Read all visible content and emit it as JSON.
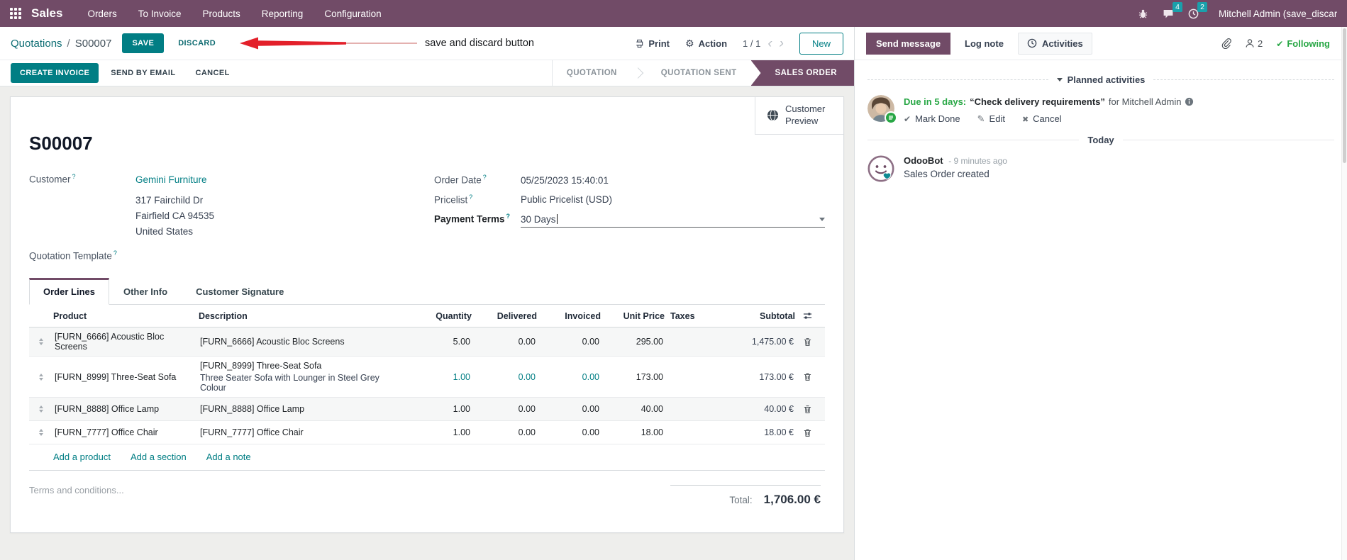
{
  "colors": {
    "brand": "#714B67",
    "accent": "#017E84",
    "badge_teal": "#1AA0AB",
    "success_green": "#28a745",
    "annotation_red": "#E3202A"
  },
  "topbar": {
    "app_name": "Sales",
    "menus": [
      "Orders",
      "To Invoice",
      "Products",
      "Reporting",
      "Configuration"
    ],
    "messages_badge": "4",
    "activities_badge": "2",
    "user_name": "Mitchell Admin (save_discar"
  },
  "control_panel": {
    "breadcrumb": "Quotations",
    "breadcrumb_sep": "/",
    "breadcrumb_active": "S00007",
    "save_label": "SAVE",
    "discard_label": "DISCARD",
    "annotation": "save and discard button",
    "print_label": "Print",
    "action_label": "Action",
    "pager": "1 / 1",
    "new_label": "New"
  },
  "statusbar": {
    "buttons": [
      "CREATE INVOICE",
      "SEND BY EMAIL",
      "CANCEL"
    ],
    "stages": [
      "QUOTATION",
      "QUOTATION SENT",
      "SALES ORDER"
    ],
    "active_stage": "SALES ORDER"
  },
  "form": {
    "customer_preview_label": "Customer Preview",
    "title": "S00007",
    "fields": {
      "customer_label": "Customer",
      "customer_name": "Gemini Furniture",
      "address_line1": "317 Fairchild Dr",
      "address_line2": "Fairfield CA 94535",
      "address_line3": "United States",
      "quotation_template_label": "Quotation Template",
      "order_date_label": "Order Date",
      "order_date_value": "05/25/2023 15:40:01",
      "pricelist_label": "Pricelist",
      "pricelist_value": "Public Pricelist (USD)",
      "payment_terms_label": "Payment Terms",
      "payment_terms_value": "30 Days"
    },
    "tabs": [
      "Order Lines",
      "Other Info",
      "Customer Signature"
    ],
    "active_tab": "Order Lines",
    "order_lines": {
      "columns": [
        "Product",
        "Description",
        "Quantity",
        "Delivered",
        "Invoiced",
        "Unit Price",
        "Taxes",
        "Subtotal"
      ],
      "rows": [
        {
          "product": "[FURN_6666] Acoustic Bloc Screens",
          "description": "[FURN_6666] Acoustic Bloc Screens",
          "description2": "",
          "quantity": "5.00",
          "delivered": "0.00",
          "invoiced": "0.00",
          "unit_price": "295.00",
          "taxes": "",
          "subtotal": "1,475.00 €",
          "highlight": false
        },
        {
          "product": "[FURN_8999] Three-Seat Sofa",
          "description": "[FURN_8999] Three-Seat Sofa",
          "description2": "Three Seater Sofa with Lounger in Steel Grey Colour",
          "quantity": "1.00",
          "delivered": "0.00",
          "invoiced": "0.00",
          "unit_price": "173.00",
          "taxes": "",
          "subtotal": "173.00 €",
          "highlight": true
        },
        {
          "product": "[FURN_8888] Office Lamp",
          "description": "[FURN_8888] Office Lamp",
          "description2": "",
          "quantity": "1.00",
          "delivered": "0.00",
          "invoiced": "0.00",
          "unit_price": "40.00",
          "taxes": "",
          "subtotal": "40.00 €",
          "highlight": false
        },
        {
          "product": "[FURN_7777] Office Chair",
          "description": "[FURN_7777] Office Chair",
          "description2": "",
          "quantity": "1.00",
          "delivered": "0.00",
          "invoiced": "0.00",
          "unit_price": "18.00",
          "taxes": "",
          "subtotal": "18.00 €",
          "highlight": false
        }
      ],
      "add_links": [
        "Add a product",
        "Add a section",
        "Add a note"
      ]
    },
    "terms_placeholder": "Terms and conditions...",
    "total_label": "Total:",
    "total_value": "1,706.00 €"
  },
  "chatter": {
    "tabs": [
      "Send message",
      "Log note",
      "Activities"
    ],
    "followers_count": "2",
    "following_label": "Following",
    "planned": {
      "section_label": "Planned activities",
      "due": "Due in 5 days:",
      "summary": "“Check delivery requirements”",
      "assignee": "for Mitchell Admin",
      "actions": [
        "Mark Done",
        "Edit",
        "Cancel"
      ]
    },
    "today_label": "Today",
    "messages": [
      {
        "author": "OdooBot",
        "time": "- 9 minutes ago",
        "body": "Sales Order created"
      }
    ]
  }
}
